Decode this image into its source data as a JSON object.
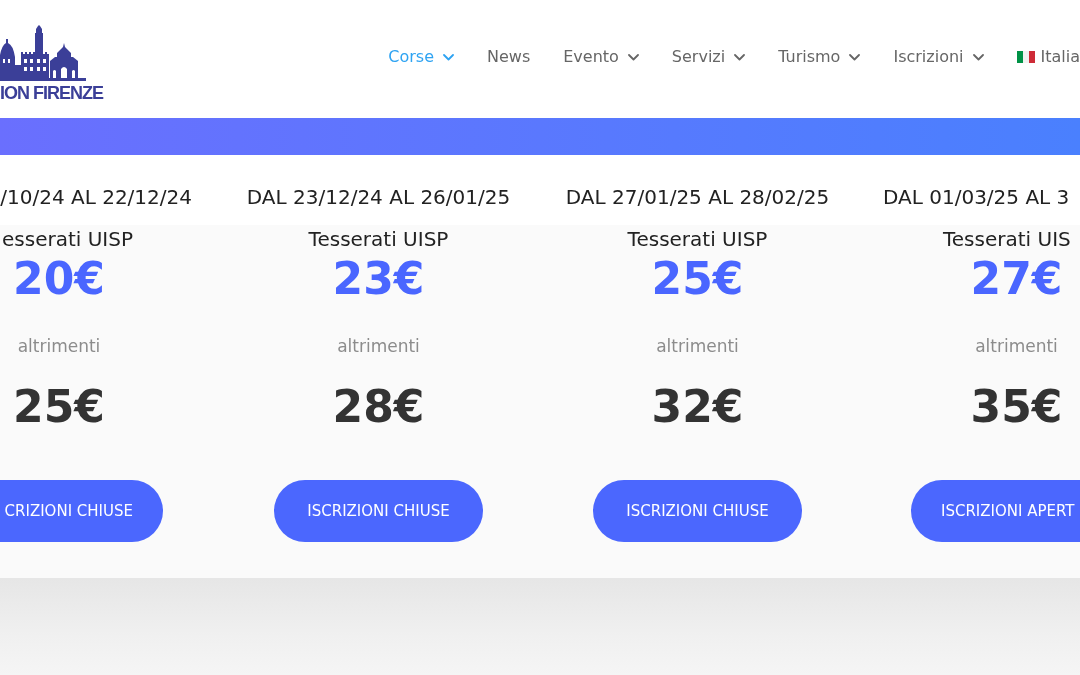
{
  "logo": {
    "text": "ION FIRENZE"
  },
  "nav": [
    {
      "label": "Corse",
      "dropdown": true,
      "selected": true
    },
    {
      "label": "News",
      "dropdown": false,
      "selected": false
    },
    {
      "label": "Evento",
      "dropdown": true,
      "selected": false
    },
    {
      "label": "Servizi",
      "dropdown": true,
      "selected": false
    },
    {
      "label": "Turismo",
      "dropdown": true,
      "selected": false
    },
    {
      "label": "Iscrizioni",
      "dropdown": true,
      "selected": false
    }
  ],
  "language": {
    "label": "Italia"
  },
  "pricing": [
    {
      "period": "/10/24 AL 22/12/24",
      "member_label": "esserati UISP",
      "member_price": "20€",
      "other_label": "altrimenti",
      "other_price": "25€",
      "button": "CRIZIONI CHIUSE"
    },
    {
      "period": "DAL 23/12/24 AL 26/01/25",
      "member_label": "Tesserati UISP",
      "member_price": "23€",
      "other_label": "altrimenti",
      "other_price": "28€",
      "button": "ISCRIZIONI CHIUSE"
    },
    {
      "period": "DAL 27/01/25 AL 28/02/25",
      "member_label": "Tesserati UISP",
      "member_price": "25€",
      "other_label": "altrimenti",
      "other_price": "32€",
      "button": "ISCRIZIONI CHIUSE"
    },
    {
      "period": "DAL 01/03/25 AL 3",
      "member_label": "Tesserati UIS",
      "member_price": "27€",
      "other_label": "altrimenti",
      "other_price": "35€",
      "button": "ISCRIZIONI APERT"
    }
  ]
}
